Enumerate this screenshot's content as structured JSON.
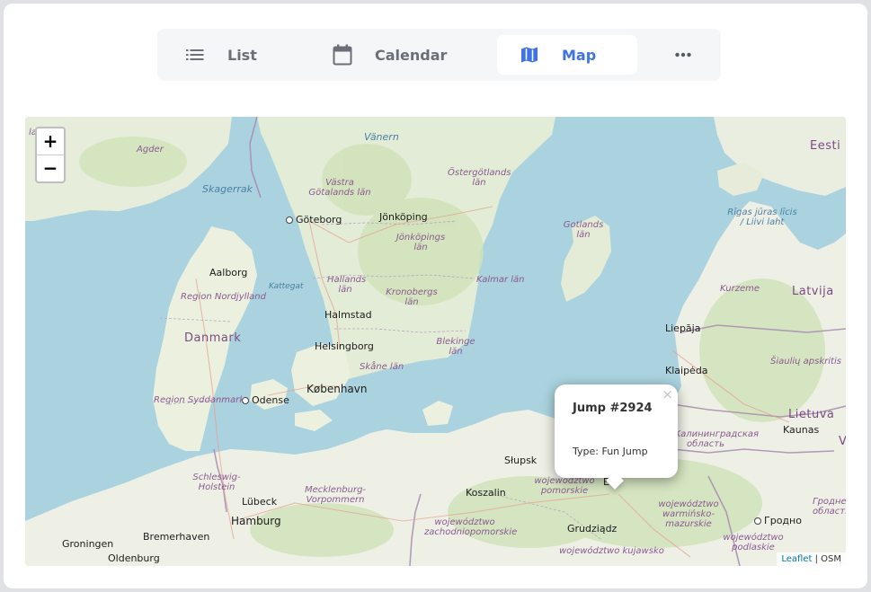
{
  "view_switcher": {
    "tabs": [
      {
        "label": "List",
        "icon": "list-icon",
        "active": false
      },
      {
        "label": "Calendar",
        "icon": "calendar-icon",
        "active": false
      },
      {
        "label": "Map",
        "icon": "map-icon",
        "active": true
      },
      {
        "label": "",
        "icon": "more-horizontal-icon",
        "active": false
      }
    ],
    "accent_color": "#3f73e6"
  },
  "map": {
    "zoom_in_label": "+",
    "zoom_out_label": "−",
    "labels": {
      "countries": [
        "Danmark",
        "Latvija",
        "Lietuva",
        "Eesti"
      ],
      "cities": [
        "Göteborg",
        "Jönköping",
        "Aalborg",
        "Halmstad",
        "Helsingborg",
        "København",
        "Odense",
        "Liepāja",
        "Klaipėda",
        "Kaunas",
        "Słupsk",
        "Koszalin",
        "Grudziądz",
        "Lübeck",
        "Hamburg",
        "Bremerhaven",
        "Groningen",
        "Oldenburg",
        "Гродно"
      ],
      "regions": [
        "Agder",
        "Västra Götalands län",
        "Östergötlands län",
        "Jönköpings län",
        "Hallands län",
        "Kronobergs län",
        "Kalmar län",
        "Blekinge län",
        "Skåne län",
        "Gotlands län",
        "Region Nordjylland",
        "Region Syddanmark",
        "Schleswig-Holstein",
        "Mecklenburg-Vorpommern",
        "województwo pomorskie",
        "województwo zachodniopomorskie",
        "województwo warmińsko-mazurskie",
        "województwo podlaskie",
        "województwo kujawsko",
        "Kurzeme",
        "Šiaulių apskritis",
        "Калининградская область",
        "Гродненская область",
        "Rīgas jūras līcis / Liivi laht"
      ],
      "seas": [
        "Skagerrak",
        "Kattegat",
        "Vänern"
      ],
      "misc": [
        "land",
        "Ełk",
        "V"
      ]
    }
  },
  "popup": {
    "close_label": "×",
    "title": "Jump #2924",
    "type_text": "Type: Fun Jump"
  },
  "attribution": {
    "leaflet_label": "Leaflet",
    "separator": "|",
    "osm_label": "OSM"
  }
}
